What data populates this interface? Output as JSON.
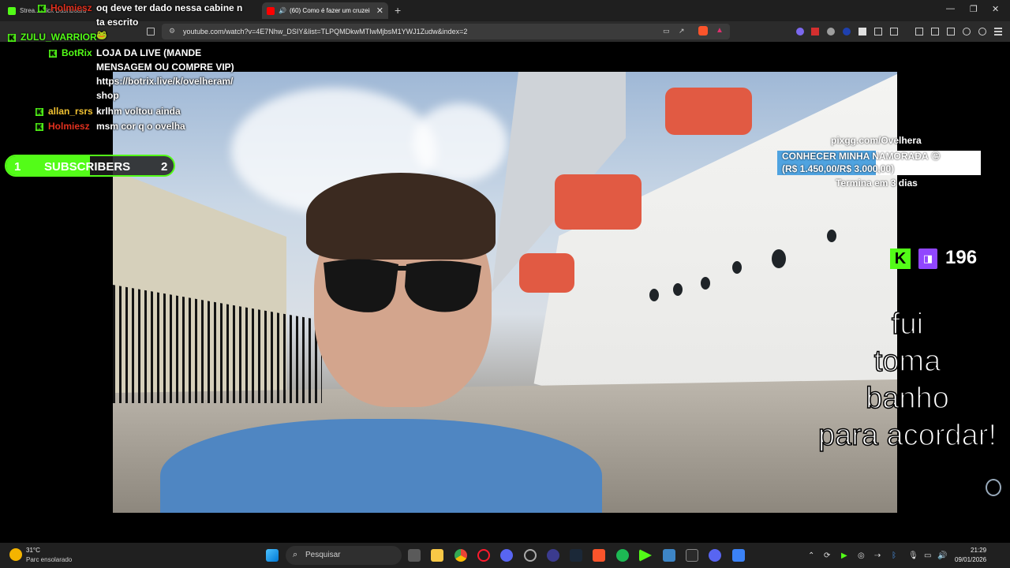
{
  "browser": {
    "tabs": [
      {
        "title": "Strea... Kick Dashboard",
        "active": false
      },
      {
        "title": "(60) Como é fazer um cruzeiro",
        "active": true
      }
    ],
    "url": "youtube.com/watch?v=4E7Nhw_DSIY&list=TLPQMDkwMTIwMjbsM1YWJ1Zudw&index=2"
  },
  "chat": [
    {
      "user": "Holmiesz",
      "color": "#e0301e",
      "text": "oq deve ter dado nessa cabine n"
    },
    {
      "user": "",
      "color": "#ffffff",
      "text": "ta escrito"
    },
    {
      "user": "ZULU_WARRIOR",
      "color": "#53fc18",
      "text": ""
    },
    {
      "user": "BotRix",
      "color": "#53fc18",
      "text": "LOJA DA LIVE (MANDE"
    },
    {
      "user": "",
      "color": "#ffffff",
      "text": "MENSAGEM OU COMPRE VIP)"
    },
    {
      "user": "",
      "color": "#ffffff",
      "text": "https://botrix.live/k/ovelheram/"
    },
    {
      "user": "",
      "color": "#ffffff",
      "text": "shop"
    },
    {
      "user": "allan_rsrs",
      "color": "#f1c232",
      "text": "krlhm voltou ainda"
    },
    {
      "user": "Holmiesz",
      "color": "#e0301e",
      "text": "msm cor q o ovelha"
    }
  ],
  "subs_goal": {
    "current": "1",
    "label": "SUBSCRIBERS",
    "target": "2",
    "progress": 0.5
  },
  "donation": {
    "link": "pixgg.com/Ovelhera",
    "goal_title": "CONHECER MINHA NAMORADA 😘",
    "goal_amount": "(R$ 1.450,00/R$ 3.000,00)",
    "progress": 0.4833,
    "ends": "Termina em 3 dias"
  },
  "viewers": {
    "count": "196"
  },
  "caption_lines": [
    "fui",
    "toma",
    "banho",
    "para acordar!"
  ],
  "taskbar": {
    "weather_temp": "31°C",
    "weather_desc": "Parc ensolarado",
    "search_placeholder": "Pesquisar",
    "time": "21:29",
    "date": "09/01/2026"
  }
}
